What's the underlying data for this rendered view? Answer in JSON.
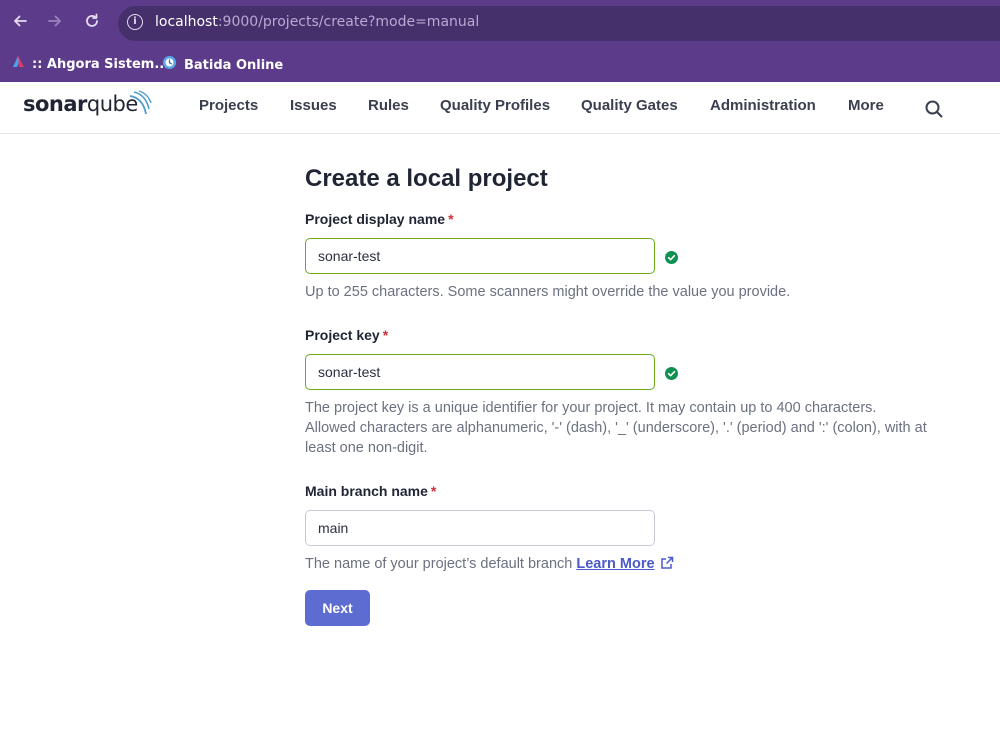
{
  "browser": {
    "url_host": "localhost",
    "url_rest": ":9000/projects/create?mode=manual",
    "bookmarks": [
      {
        "label": ":: Ahgora Sistem..."
      },
      {
        "label": "Batida Online"
      }
    ]
  },
  "app": {
    "logo_part1": "sonar",
    "logo_part2": "qube",
    "menu": [
      {
        "label": "Projects"
      },
      {
        "label": "Issues"
      },
      {
        "label": "Rules"
      },
      {
        "label": "Quality Profiles"
      },
      {
        "label": "Quality Gates"
      },
      {
        "label": "Administration"
      },
      {
        "label": "More"
      }
    ]
  },
  "form": {
    "title": "Create a local project",
    "display_name": {
      "label": "Project display name",
      "required_mark": "*",
      "value": "sonar-test",
      "help": "Up to 255 characters. Some scanners might override the value you provide."
    },
    "project_key": {
      "label": "Project key",
      "required_mark": "*",
      "value": "sonar-test",
      "help_line1": "The project key is a unique identifier for your project. It may contain up to 400 characters.",
      "help_line2": "Allowed characters are alphanumeric, '-' (dash), '_' (underscore), '.' (period) and ':' (colon), with at",
      "help_line3": "least one non-digit."
    },
    "main_branch": {
      "label": "Main branch name",
      "required_mark": "*",
      "value": "main",
      "help": "The name of your project’s default branch",
      "learn_more": "Learn More"
    },
    "next_label": "Next"
  },
  "colors": {
    "browser_bar": "#5c3c8a",
    "valid_border": "#6ba81a",
    "valid_check": "#0f9151",
    "primary_button": "#5d6cd1",
    "link": "#4b59c9",
    "required": "#d02f3a"
  },
  "icons": [
    "back-arrow-icon",
    "forward-arrow-icon",
    "reload-icon",
    "info-icon",
    "search-icon",
    "check-circle-icon",
    "external-link-icon"
  ]
}
